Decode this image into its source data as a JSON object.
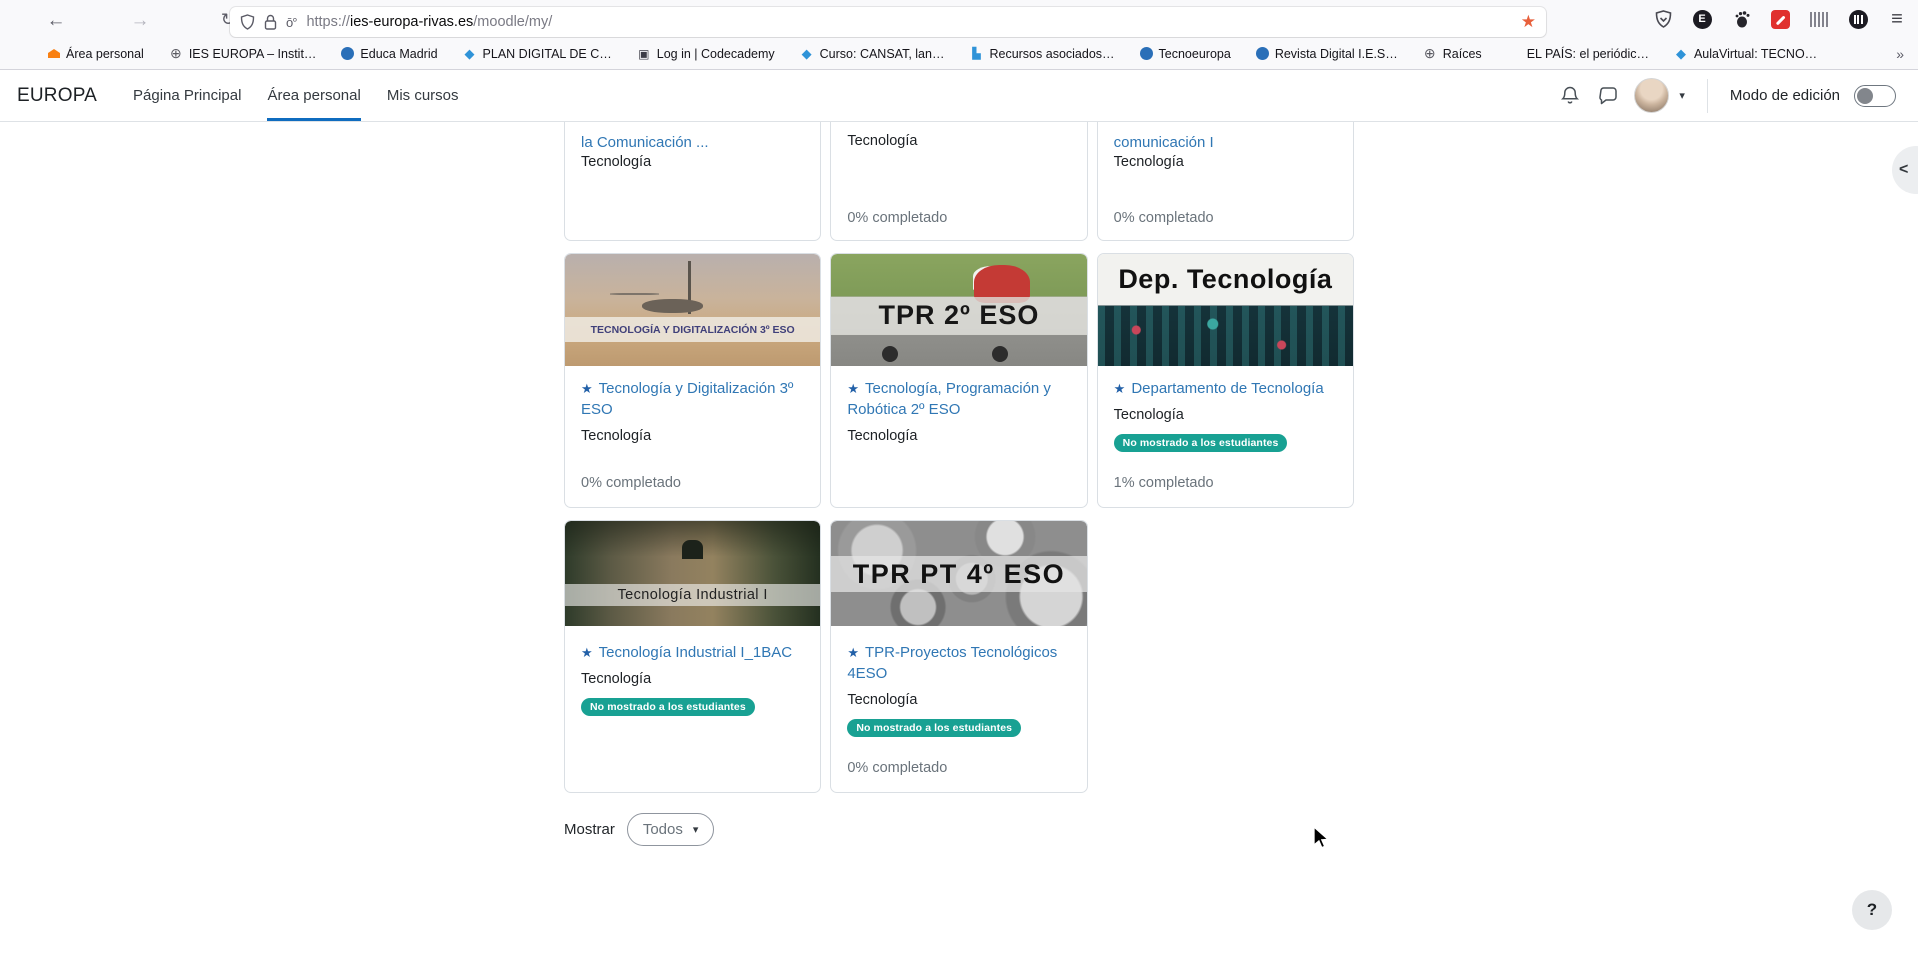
{
  "browser": {
    "url": {
      "protocol": "https://",
      "domain": "ies-europa-rivas.es",
      "path": "/moodle/my/"
    },
    "toolbar_icons": [
      "back-icon",
      "forward-icon",
      "reload-icon",
      "shield-icon",
      "lock-icon",
      "permissions-icon",
      "bookmark-star-icon",
      "ext-shield-icon",
      "ext-e-badge-icon",
      "gnome-foot-icon",
      "magic-wand-icon",
      "barcode-icon",
      "wayback-icon",
      "menu-icon"
    ],
    "ext_e_letter": "E",
    "bookmarks": [
      {
        "label": "Área personal",
        "icon": "moodle-cap"
      },
      {
        "label": "IES EUROPA – Instit…",
        "icon": "globe"
      },
      {
        "label": "Educa Madrid",
        "icon": "circle-blue"
      },
      {
        "label": "PLAN DIGITAL DE C…",
        "icon": "diamond-blue"
      },
      {
        "label": "Log in | Codecademy",
        "icon": "doc-dark"
      },
      {
        "label": "Curso: CANSAT, lan…",
        "icon": "diamond-blue"
      },
      {
        "label": "Recursos asociados…",
        "icon": "blocks-blue"
      },
      {
        "label": "Tecnoeuropa",
        "icon": "circle-blue"
      },
      {
        "label": "Revista Digital I.E.S…",
        "icon": "circle-blue"
      },
      {
        "label": "Raíces",
        "icon": "globe"
      },
      {
        "label": "EL PAÍS: el periódic…",
        "icon": "elpais"
      },
      {
        "label": "AulaVirtual: TECNO…",
        "icon": "diamond-blue"
      }
    ]
  },
  "navbar": {
    "brand": "EUROPA",
    "items": [
      {
        "label": "Página Principal",
        "active": false
      },
      {
        "label": "Área personal",
        "active": true
      },
      {
        "label": "Mis cursos",
        "active": false
      }
    ],
    "edit_mode_label": "Modo de edición",
    "edit_mode_on": false
  },
  "courses": {
    "row1": [
      {
        "title_tail": "la Comunicación ...",
        "category": "Tecnología",
        "completion": ""
      },
      {
        "title_tail": "",
        "category": "Tecnología",
        "completion": "0% completado"
      },
      {
        "title_tail": "comunicación I",
        "category": "Tecnología",
        "completion": "0% completado"
      }
    ],
    "row2": [
      {
        "image_caption": "TECNOLOGÍA Y DIGITALIZACIÓN 3º ESO",
        "title": "Tecnología y Digitalización 3º ESO",
        "category": "Tecnología",
        "badge": "",
        "completion": "0% completado"
      },
      {
        "image_caption": "TPR 2º ESO",
        "title": "Tecnología, Programación y Robótica 2º ESO",
        "category": "Tecnología",
        "badge": "",
        "completion": ""
      },
      {
        "image_caption": "Dep. Tecnología",
        "title": "Departamento de Tecnología",
        "category": "Tecnología",
        "badge": "No mostrado a los estudiantes",
        "completion": "1% completado"
      }
    ],
    "row3": [
      {
        "image_caption": "Tecnología Industrial I",
        "title": "Tecnología Industrial I_1BAC",
        "category": "Tecnología",
        "badge": "No mostrado a los estudiantes",
        "completion": ""
      },
      {
        "image_caption": "TPR PT 4º ESO",
        "title": "TPR-Proyectos Tecnológicos 4ESO",
        "category": "Tecnología",
        "badge": "No mostrado a los estudiantes",
        "completion": "0% completado"
      }
    ]
  },
  "filter": {
    "label": "Mostrar",
    "value": "Todos"
  },
  "icons": {
    "back": "←",
    "forward": "→",
    "reload": "↻",
    "perm_badge": "ō°",
    "star": "★",
    "bookmark_star": "★",
    "menu": "≡",
    "overflow": "»",
    "chevron_down": "▾",
    "drawer_chevron": "<",
    "help": "?"
  },
  "colors": {
    "accent": "#0f6cbf",
    "link": "#3077b4",
    "badge": "#18a193",
    "bookmark_star": "#e8603c"
  }
}
